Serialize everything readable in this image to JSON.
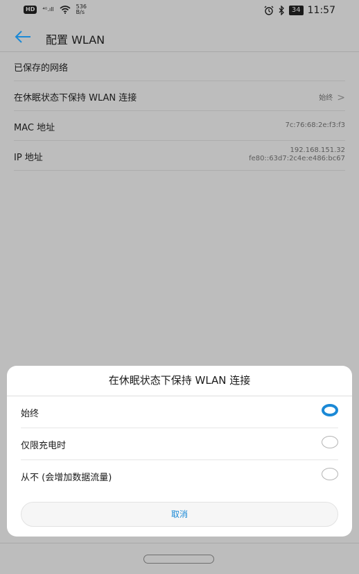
{
  "status_bar": {
    "hd": "HD",
    "network": "⁴ᴳ.ıll",
    "speed_value": "536",
    "speed_unit": "B/s",
    "battery": "34",
    "time": "11:57"
  },
  "app_bar": {
    "title": "配置 WLAN"
  },
  "settings": {
    "saved_networks": "已保存的网络",
    "sleep_keep": {
      "label": "在休眠状态下保持 WLAN 连接",
      "value": "始终"
    },
    "mac": {
      "label": "MAC 地址",
      "value": "7c:76:68:2e:f3:f3"
    },
    "ip": {
      "label": "IP 地址",
      "ipv4": "192.168.151.32",
      "ipv6": "fe80::63d7:2c4e:e486:bc67"
    }
  },
  "dialog": {
    "title": "在休眠状态下保持 WLAN 连接",
    "options": [
      {
        "label": "始终",
        "selected": true
      },
      {
        "label": "仅限充电时",
        "selected": false
      },
      {
        "label": "从不 (会增加数据流量)",
        "selected": false
      }
    ],
    "cancel": "取消"
  },
  "colors": {
    "accent": "#1b89d6",
    "dim_background": "#bdbdbd",
    "dialog_background": "#ffffff"
  }
}
